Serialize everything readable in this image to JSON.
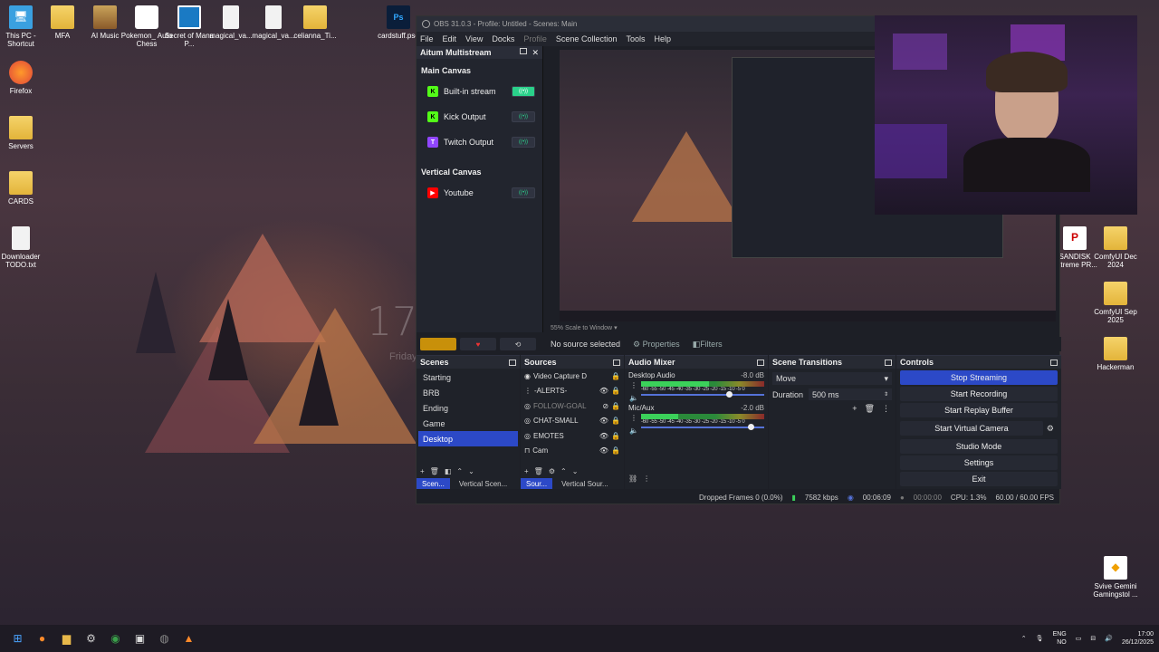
{
  "desktop": {
    "icons_left": [
      {
        "label": "This PC - Shortcut",
        "icon": "computer-icon"
      },
      {
        "label": "Firefox",
        "icon": "firefox-icon"
      },
      {
        "label": "Servers",
        "icon": "folder-icon"
      },
      {
        "label": "CARDS",
        "icon": "folder-icon"
      },
      {
        "label": "Downloader TODO.txt",
        "icon": "text-file-icon"
      }
    ],
    "icons_top": [
      {
        "label": "MFA",
        "icon": "folder-icon"
      },
      {
        "label": "AI Music",
        "icon": "folder-icon"
      },
      {
        "label": "Pokemon_ Auto Chess",
        "icon": "pokemon-icon"
      },
      {
        "label": "Secret of Mana P...",
        "icon": "app-icon"
      },
      {
        "label": "magical_va...",
        "icon": "file-icon"
      },
      {
        "label": "magical_va...",
        "icon": "file-icon"
      },
      {
        "label": "celianna_Ti...",
        "icon": "folder-icon"
      },
      {
        "label": "cardstuff.psd",
        "icon": "photoshop-icon"
      }
    ],
    "icons_right": [
      {
        "label": "SANDISK Extreme PR...",
        "icon": "drive-icon"
      },
      {
        "label": "ComfyUI Dec 2024",
        "icon": "folder-icon"
      },
      {
        "label": "ComfyUI Sep 2025",
        "icon": "folder-icon"
      },
      {
        "label": "Hackerman",
        "icon": "folder-icon"
      },
      {
        "label": "Svive Gemini Gamingstol ...",
        "icon": "shortcut-icon"
      }
    ],
    "wall_clock": "17",
    "wall_date": "Friday"
  },
  "obs": {
    "title": "OBS 31.0.3 - Profile: Untitled - Scenes: Main",
    "menu": [
      "File",
      "Edit",
      "View",
      "Docks",
      "Profile",
      "Scene Collection",
      "Tools",
      "Help"
    ],
    "multistream": {
      "title": "Aitum Multistream",
      "main_canvas_label": "Main Canvas",
      "main_outputs": [
        {
          "name": "Built-in stream",
          "color": "#53fc18",
          "letter": "K",
          "active": true
        },
        {
          "name": "Kick Output",
          "color": "#53fc18",
          "letter": "K",
          "active": false
        },
        {
          "name": "Twitch Output",
          "color": "#9146ff",
          "letter": "T",
          "active": false
        }
      ],
      "vertical_canvas_label": "Vertical Canvas",
      "vertical_outputs": [
        {
          "name": "Youtube",
          "color": "#ff0000",
          "letter": "▶",
          "active": false
        }
      ]
    },
    "preview": {
      "zoom": "55%",
      "scale_label": "Scale to Window"
    },
    "source_bar": {
      "no_source": "No source selected",
      "properties": "Properties",
      "filters": "Filters"
    },
    "scenes": {
      "title": "Scenes",
      "items": [
        "Starting",
        "BRB",
        "Ending",
        "Game",
        "Desktop"
      ],
      "selected": "Desktop",
      "tabs": [
        "Scen...",
        "Vertical Scen..."
      ]
    },
    "sources": {
      "title": "Sources",
      "items": [
        {
          "name": "Video Capture D",
          "dim": false
        },
        {
          "name": "-ALERTS-",
          "dim": false
        },
        {
          "name": "FOLLOW-GOAL",
          "dim": true
        },
        {
          "name": "CHAT-SMALL",
          "dim": false
        },
        {
          "name": "EMOTES",
          "dim": false
        },
        {
          "name": "Cam",
          "dim": false
        }
      ],
      "tabs": [
        "Sour...",
        "Vertical Sour..."
      ]
    },
    "mixer": {
      "title": "Audio Mixer",
      "channels": [
        {
          "name": "Desktop Audio",
          "db": "-8.0 dB",
          "level": 0.55,
          "volume": 0.72
        },
        {
          "name": "Mic/Aux",
          "db": "-2.0 dB",
          "level": 0.3,
          "volume": 0.9
        }
      ],
      "scale": "-60 -55 -50 -45 -40 -35 -30 -25 -20 -15 -10 -5 0"
    },
    "transitions": {
      "title": "Scene Transitions",
      "selected": "Move",
      "duration_label": "Duration",
      "duration_value": "500 ms"
    },
    "controls": {
      "title": "Controls",
      "buttons": [
        "Stop Streaming",
        "Start Recording",
        "Start Replay Buffer",
        "Start Virtual Camera",
        "Studio Mode",
        "Settings",
        "Exit"
      ]
    },
    "status": {
      "dropped": "Dropped Frames 0 (0.0%)",
      "kbps": "7582 kbps",
      "stream_time": "00:06:09",
      "rec_time": "00:00:00",
      "cpu": "CPU: 1.3%",
      "fps": "60.00 / 60.00 FPS"
    }
  },
  "taskbar": {
    "lang_top": "ENG",
    "lang_bottom": "NO",
    "time": "17:00",
    "date": "26/12/2025"
  }
}
